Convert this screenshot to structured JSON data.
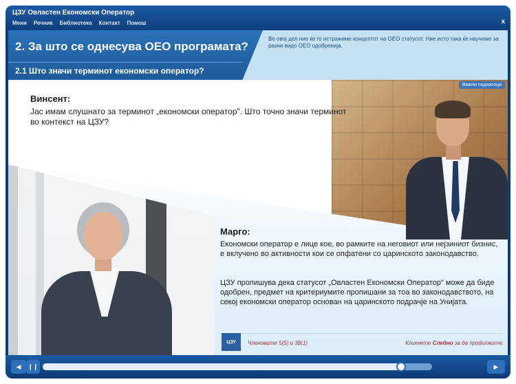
{
  "app": {
    "title": "ЦЗУ Овластен Економски Оператор",
    "menu": [
      "Мени",
      "Речник",
      "Библиотека",
      "Контакт",
      "Помош"
    ],
    "close": "x"
  },
  "header": {
    "section_title": "2. За што се однесува ОЕО програмата?",
    "sub_title": "2.1 Што значи терминот економски оператор?",
    "note": "Во овој дел ние ќе го истражиме концептот на ОЕО статусот. Ние исто така ќе научиме за разни видо ОЕО одобренија."
  },
  "glossary_button": "Важни поднатоци",
  "dialogue": {
    "speaker1": "Винсент:",
    "speech1": "Јас имам слушнато за терминот „економски оператор\". Што точно значи терминот во контекст на ЦЗУ?",
    "speaker2": "Марго:",
    "speech2a": "Економски оператор е лице кое, во рамките на неговиот или нејзиниот бизнис, е вклучено во активности кои се опфатени со царинското законодавство.",
    "speech2b": "ЦЗУ пропишува дека статусот „Овластен Економски Оператор\" може да биде одобрен, предмет на критериумите пропишани за тоа во законодавството, на секој економски оператор основан на царинското подрачје на Унијата."
  },
  "footer": {
    "badge": "ЦЗУ",
    "article_ref": "Членовите 5(5) и 38(1)",
    "continue_pre": "Кликнете ",
    "continue_bold": "Следно",
    "continue_post": " за да продолжите."
  },
  "controls": {
    "sound_icon": "speaker-icon",
    "pause_icon": "pause-icon",
    "next_icon": "next-icon",
    "progress": 0.92
  }
}
